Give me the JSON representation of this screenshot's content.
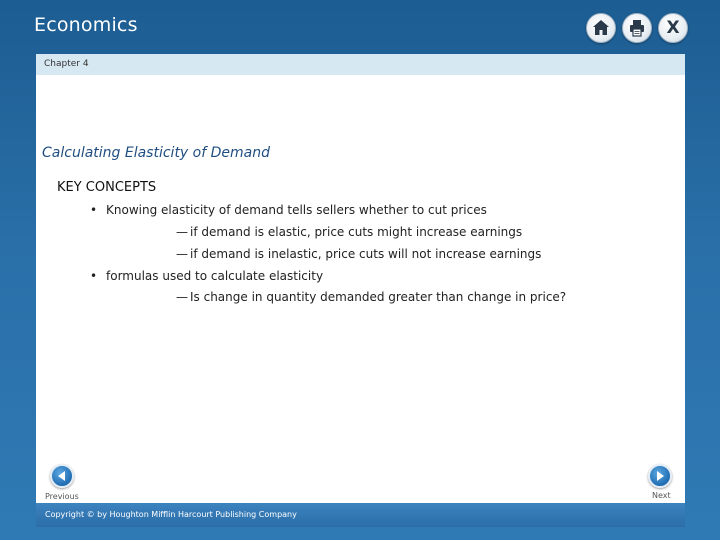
{
  "app": {
    "title": "Economics"
  },
  "toolbar": {
    "home_icon": "home-icon",
    "print_icon": "print-icon",
    "close_icon": "close-icon",
    "close_glyph": "X"
  },
  "chapter": {
    "label": "Chapter 4"
  },
  "slide": {
    "heading": "Calculating Elasticity of Demand",
    "section_title": "KEY CONCEPTS",
    "bullet_glyph": "•",
    "dash_glyph": "—",
    "bullets": [
      {
        "text": "Knowing elasticity of demand tells sellers whether to cut prices",
        "subpoints": [
          "if demand is elastic, price cuts might increase earnings",
          "if demand is inelastic, price cuts will not increase earnings"
        ]
      },
      {
        "text": "formulas used to calculate elasticity",
        "subpoints": [
          "Is change in quantity demanded greater than change in price?"
        ]
      }
    ]
  },
  "nav": {
    "previous_label": "Previous",
    "next_label": "Next"
  },
  "footer": {
    "copyright": "Copyright © by Houghton Mifflin Harcourt Publishing Company"
  },
  "colors": {
    "frame_blue": "#2a6fa8",
    "chapter_band": "#d6e8f2",
    "heading_blue": "#1f4e80",
    "nav_blue": "#1f6db3"
  }
}
